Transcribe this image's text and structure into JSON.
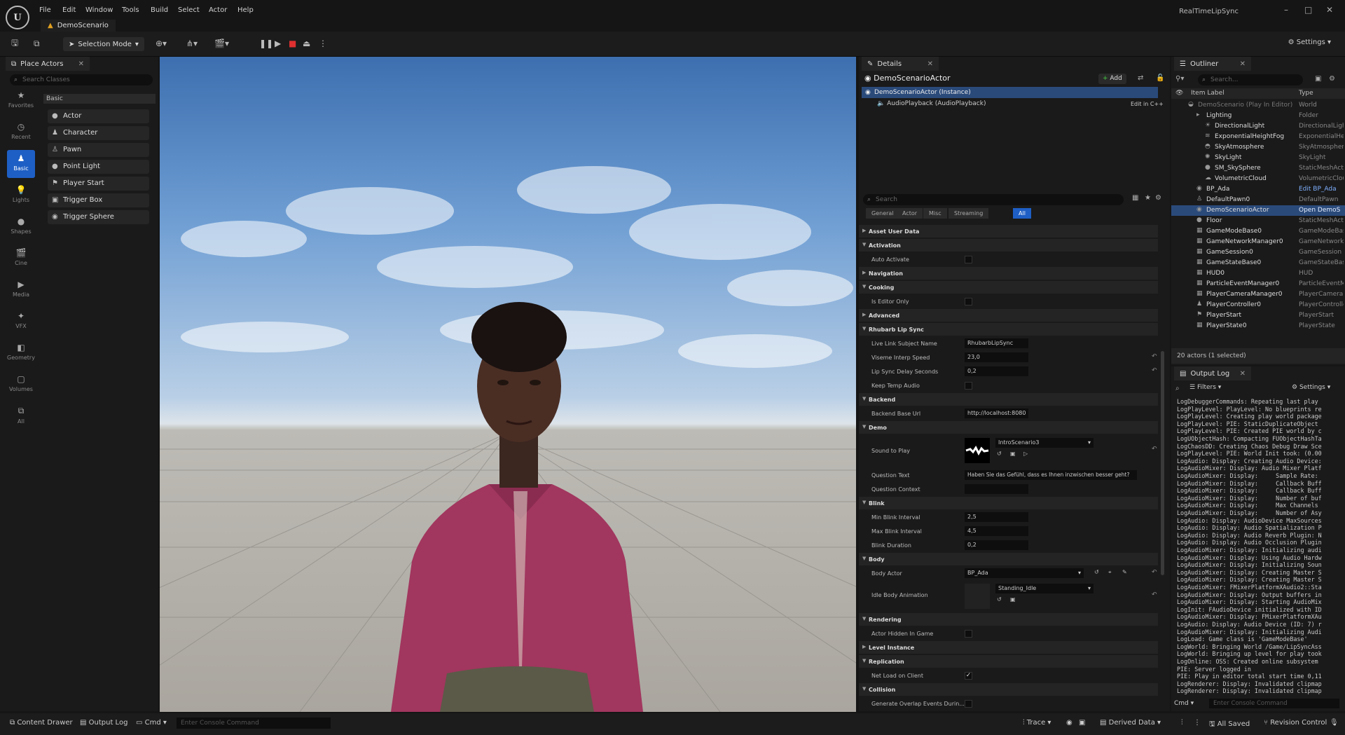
{
  "app": {
    "logo": "U",
    "doc_tab": "DemoScenario",
    "project": "RealTimeLipSync"
  },
  "menu": [
    "File",
    "Edit",
    "Window",
    "Tools",
    "Build",
    "Select",
    "Actor",
    "Help"
  ],
  "window_controls": {
    "minimize": "–",
    "maximize": "□",
    "close": "✕"
  },
  "toolbar": {
    "selection_mode": "Selection Mode",
    "settings": "Settings"
  },
  "place_actors": {
    "tab": "Place Actors",
    "search_placeholder": "Search Classes",
    "categories": [
      "Favorites",
      "Recent",
      "Basic",
      "Lights",
      "Shapes",
      "Cine",
      "Media",
      "VFX",
      "Geometry",
      "Volumes",
      "All"
    ],
    "basic_label": "Basic",
    "items": [
      "Actor",
      "Character",
      "Pawn",
      "Point Light",
      "Player Start",
      "Trigger Box",
      "Trigger Sphere"
    ]
  },
  "details": {
    "tab": "Details",
    "actor_name": "DemoScenarioActor",
    "add_label": "Add",
    "instance": "DemoScenarioActor (Instance)",
    "component": "AudioPlayback (AudioPlayback)",
    "edit_cpp": "Edit in C++",
    "search_placeholder": "Search",
    "filter_tabs": [
      "General",
      "Actor",
      "Misc",
      "Streaming",
      "All"
    ],
    "sections": {
      "asset_user_data": "Asset User Data",
      "activation": "Activation",
      "navigation": "Navigation",
      "cooking": "Cooking",
      "advanced": "Advanced",
      "rhubarb": "Rhubarb Lip Sync",
      "backend": "Backend",
      "demo": "Demo",
      "blink": "Blink",
      "body": "Body",
      "rendering": "Rendering",
      "level_instance": "Level Instance",
      "replication": "Replication",
      "collision": "Collision"
    },
    "props": {
      "auto_activate": "Auto Activate",
      "is_editor_only": "Is Editor Only",
      "live_link_subject_name": {
        "label": "Live Link Subject Name",
        "value": "RhubarbLipSync"
      },
      "viseme_interp_speed": {
        "label": "Viseme Interp Speed",
        "value": "23,0"
      },
      "lip_sync_delay": {
        "label": "Lip Sync Delay Seconds",
        "value": "0,2"
      },
      "keep_temp_audio": "Keep Temp Audio",
      "backend_base_url": {
        "label": "Backend Base Url",
        "value": "http://localhost:8080"
      },
      "sound_to_play": {
        "label": "Sound to Play",
        "value": "IntroScenario3"
      },
      "question_text": {
        "label": "Question Text",
        "value": "Haben Sie das Gefühl, dass es Ihnen inzwischen besser geht?"
      },
      "question_context": {
        "label": "Question Context",
        "value": ""
      },
      "min_blink": {
        "label": "Min Blink Interval",
        "value": "2,5"
      },
      "max_blink": {
        "label": "Max Blink Interval",
        "value": "4,5"
      },
      "blink_duration": {
        "label": "Blink Duration",
        "value": "0,2"
      },
      "body_actor": {
        "label": "Body Actor",
        "value": "BP_Ada"
      },
      "idle_body_animation": {
        "label": "Idle Body Animation",
        "value": "Standing_Idle"
      },
      "actor_hidden": "Actor Hidden In Game",
      "net_load": "Net Load on Client",
      "gen_overlap": "Generate Overlap Events Durin..."
    }
  },
  "outliner": {
    "tab": "Outliner",
    "search_placeholder": "Search...",
    "col_label": "Item Label",
    "col_type": "Type",
    "rows": [
      {
        "name": "DemoScenario (Play In Editor)",
        "type": "World"
      },
      {
        "name": "Lighting",
        "type": "Folder"
      },
      {
        "name": "DirectionalLight",
        "type": "DirectionalLight"
      },
      {
        "name": "ExponentialHeightFog",
        "type": "ExponentialHeightFog"
      },
      {
        "name": "SkyAtmosphere",
        "type": "SkyAtmosphere"
      },
      {
        "name": "SkyLight",
        "type": "SkyLight"
      },
      {
        "name": "SM_SkySphere",
        "type": "StaticMeshActor"
      },
      {
        "name": "VolumetricCloud",
        "type": "VolumetricCloud"
      },
      {
        "name": "BP_Ada",
        "type": "Edit BP_Ada"
      },
      {
        "name": "DefaultPawn0",
        "type": "DefaultPawn"
      },
      {
        "name": "DemoScenarioActor",
        "type": "Open DemoS"
      },
      {
        "name": "Floor",
        "type": "StaticMeshActor"
      },
      {
        "name": "GameModeBase0",
        "type": "GameModeBase"
      },
      {
        "name": "GameNetworkManager0",
        "type": "GameNetworkManager"
      },
      {
        "name": "GameSession0",
        "type": "GameSession"
      },
      {
        "name": "GameStateBase0",
        "type": "GameStateBase"
      },
      {
        "name": "HUD0",
        "type": "HUD"
      },
      {
        "name": "ParticleEventManager0",
        "type": "ParticleEventManager"
      },
      {
        "name": "PlayerCameraManager0",
        "type": "PlayerCameraManager"
      },
      {
        "name": "PlayerController0",
        "type": "PlayerController"
      },
      {
        "name": "PlayerStart",
        "type": "PlayerStart"
      },
      {
        "name": "PlayerState0",
        "type": "PlayerState"
      }
    ],
    "status": "20 actors (1 selected)"
  },
  "output_log": {
    "tab": "Output Log",
    "filters": "Filters",
    "settings": "Settings",
    "lines": [
      "LogDebuggerCommands: Repeating last play",
      "LogPlayLevel: PlayLevel: No blueprints re",
      "LogPlayLevel: Creating play world package",
      "LogPlayLevel: PIE: StaticDuplicateObject",
      "LogPlayLevel: PIE: Created PIE world by c",
      "LogUObjectHash: Compacting FUObjectHashTa",
      "LogChaosDD: Creating Chaos Debug Draw Sce",
      "LogPlayLevel: PIE: World Init took: (0.00",
      "LogAudio: Display: Creating Audio Device:",
      "LogAudioMixer: Display: Audio Mixer Platf",
      "LogAudioMixer: Display:     Sample Rate:",
      "LogAudioMixer: Display:     Callback Buff",
      "LogAudioMixer: Display:     Callback Buff",
      "LogAudioMixer: Display:     Number of buf",
      "LogAudioMixer: Display:     Max Channels",
      "LogAudioMixer: Display:     Number of Asy",
      "LogAudio: Display: AudioDevice MaxSources",
      "LogAudio: Display: Audio Spatialization P",
      "LogAudio: Display: Audio Reverb Plugin: N",
      "LogAudio: Display: Audio Occlusion Plugin",
      "LogAudioMixer: Display: Initializing audi",
      "LogAudioMixer: Display: Using Audio Hardw",
      "LogAudioMixer: Display: Initializing Soun",
      "LogAudioMixer: Display: Creating Master S",
      "LogAudioMixer: Display: Creating Master S",
      "LogAudioMixer: FMixerPlatformXAudio2::Sta",
      "LogAudioMixer: Display: Output buffers in",
      "LogAudioMixer: Display: Starting AudioMix",
      "LogInit: FAudioDevice initialized with ID",
      "LogAudioMixer: Display: FMixerPlatformXAu",
      "LogAudio: Display: Audio Device (ID: 7) r",
      "LogAudioMixer: Display: Initializing Audi",
      "LogLoad: Game class is 'GameModeBase'",
      "LogWorld: Bringing World /Game/LipSyncAss",
      "LogWorld: Bringing up level for play took",
      "LogOnline: OSS: Created online subsystem",
      "PIE: Server logged in",
      "PIE: Play in editor total start time 0,11",
      "LogRenderer: Display: Invalidated clipmap",
      "LogRenderer: Display: Invalidated clipmap"
    ],
    "cmd": "Cmd",
    "console_placeholder": "Enter Console Command"
  },
  "statusbar": {
    "content_drawer": "Content Drawer",
    "output_log": "Output Log",
    "cmd": "Cmd",
    "console_placeholder": "Enter Console Command",
    "trace": "Trace",
    "derived_data": "Derived Data",
    "all_saved": "All Saved",
    "revision_control": "Revision Control"
  },
  "colors": {
    "accent": "#1e5fc5",
    "panel": "#1a1a1a",
    "bg": "#151515",
    "select_row": "#2a4a7a"
  }
}
